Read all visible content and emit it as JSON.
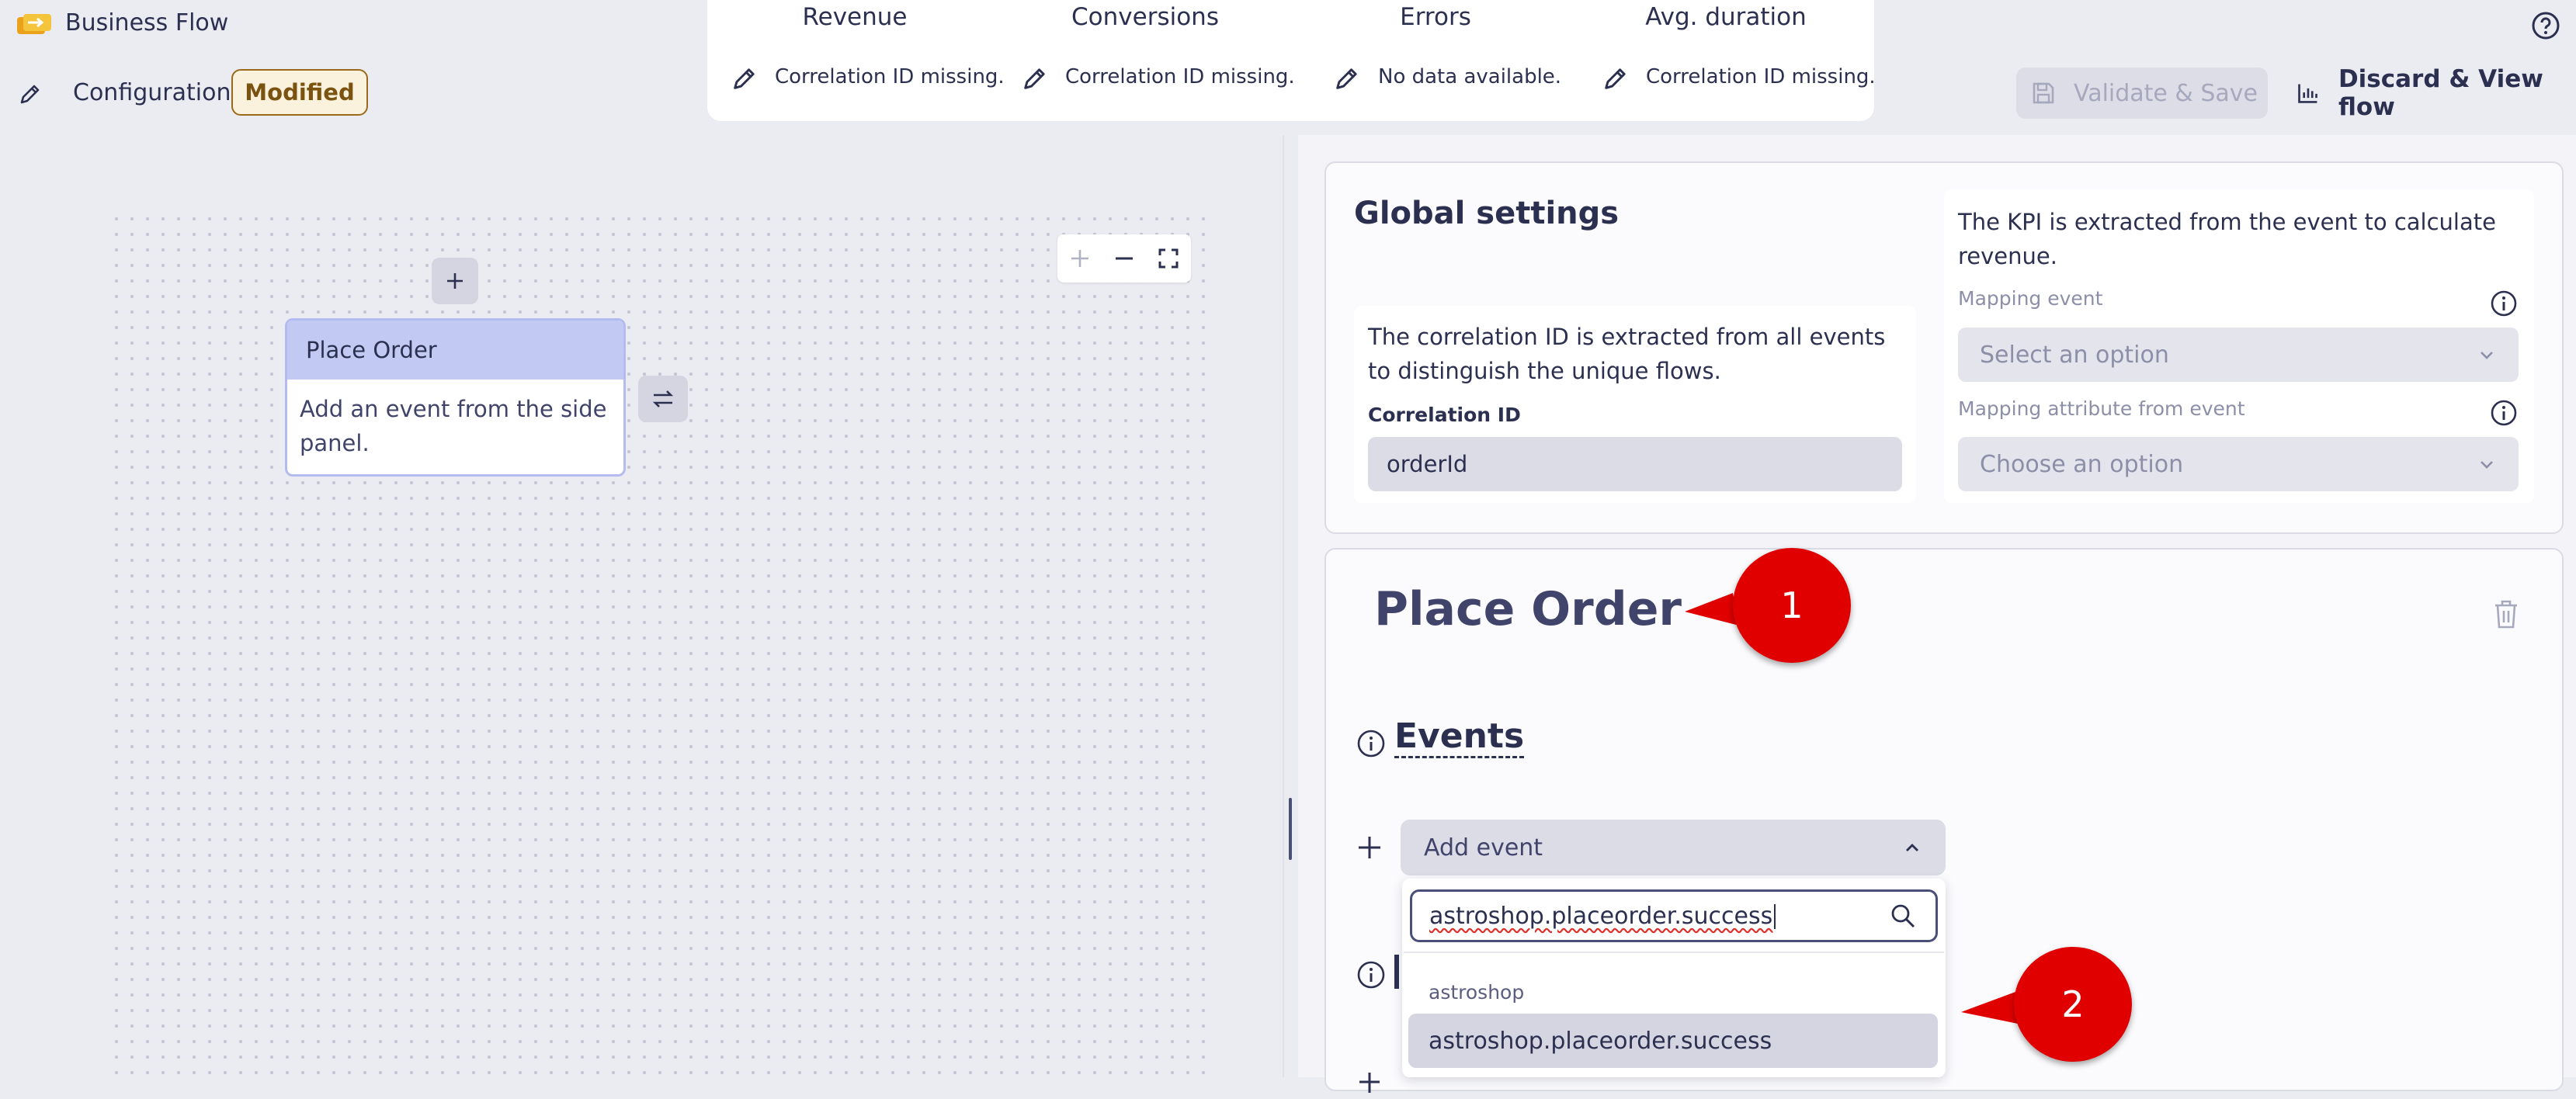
{
  "app": {
    "title": "Business Flow",
    "icon": "folder-flow-icon"
  },
  "toolbar": {
    "config_label": "Configuration",
    "modified_badge": "Modified",
    "validate_label": "Validate & Save",
    "discard_label": "Discard & View flow"
  },
  "kpis": [
    {
      "header": "Revenue",
      "status": "Correlation ID missing."
    },
    {
      "header": "Conversions",
      "status": "Correlation ID missing."
    },
    {
      "header": "Errors",
      "status": "No data available."
    },
    {
      "header": "Avg. duration",
      "status": "Correlation ID missing."
    }
  ],
  "canvas": {
    "node_title": "Place Order",
    "node_body": "Add an event from the side panel."
  },
  "global_settings": {
    "title": "Global settings",
    "correlation_desc": "The correlation ID is extracted from all events to distinguish the unique flows.",
    "correlation_label": "Correlation ID",
    "correlation_value": "orderId",
    "kpi_desc": "The KPI is extracted from the event to calculate revenue.",
    "mapping_event_label": "Mapping event",
    "mapping_event_placeholder": "Select an option",
    "mapping_attr_label": "Mapping attribute from event",
    "mapping_attr_placeholder": "Choose an option"
  },
  "step": {
    "title": "Place Order",
    "events_title": "Events",
    "add_event_label": "Add event",
    "search_value": "astroshop.placeorder.success",
    "group_label": "astroshop",
    "option_label": "astroshop.placeorder.success"
  },
  "annotations": [
    "1",
    "2"
  ],
  "colors": {
    "accent": "#c2c9f2",
    "annotation": "#e00000",
    "badge": "#9a6a1a"
  }
}
